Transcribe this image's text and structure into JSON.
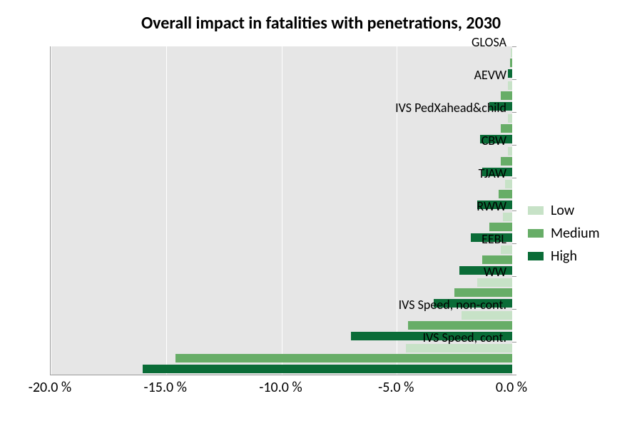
{
  "chart_data": {
    "type": "bar",
    "orientation": "horizontal",
    "title": "Overall impact in fatalities with penetrations, 2030",
    "xlabel": "",
    "ylabel": "",
    "xlim": [
      -20.0,
      0.0
    ],
    "x_ticks": [
      -20.0,
      -15.0,
      -10.0,
      -5.0,
      0.0
    ],
    "x_tick_labels": [
      "-20.0 %",
      "-15.0 %",
      "-10.0 %",
      "-5.0 %",
      "0.0 %"
    ],
    "categories": [
      "GLOSA",
      "AEVW",
      "IVS PedXahead&child",
      "CBW",
      "TJAW",
      "RWW",
      "EEBL",
      "WW",
      "IVS Speed, non-cont.",
      "IVS Speed, cont."
    ],
    "series": [
      {
        "name": "Low",
        "values": [
          -0.05,
          -0.2,
          -0.2,
          -0.2,
          -0.3,
          -0.4,
          -0.5,
          -1.5,
          -2.2,
          -4.6
        ]
      },
      {
        "name": "Medium",
        "values": [
          -0.1,
          -0.5,
          -0.5,
          -0.5,
          -0.6,
          -1.0,
          -1.3,
          -2.5,
          -4.5,
          -14.6
        ]
      },
      {
        "name": "High",
        "values": [
          -0.2,
          -1.0,
          -1.4,
          -1.3,
          -1.5,
          -1.8,
          -2.3,
          -3.4,
          -7.0,
          -16.0
        ]
      }
    ],
    "legend": {
      "position": "right",
      "labels": [
        "Low",
        "Medium",
        "High"
      ]
    },
    "colors": {
      "Low": "#c7e2c7",
      "Medium": "#67ad67",
      "High": "#0a6c37"
    }
  }
}
